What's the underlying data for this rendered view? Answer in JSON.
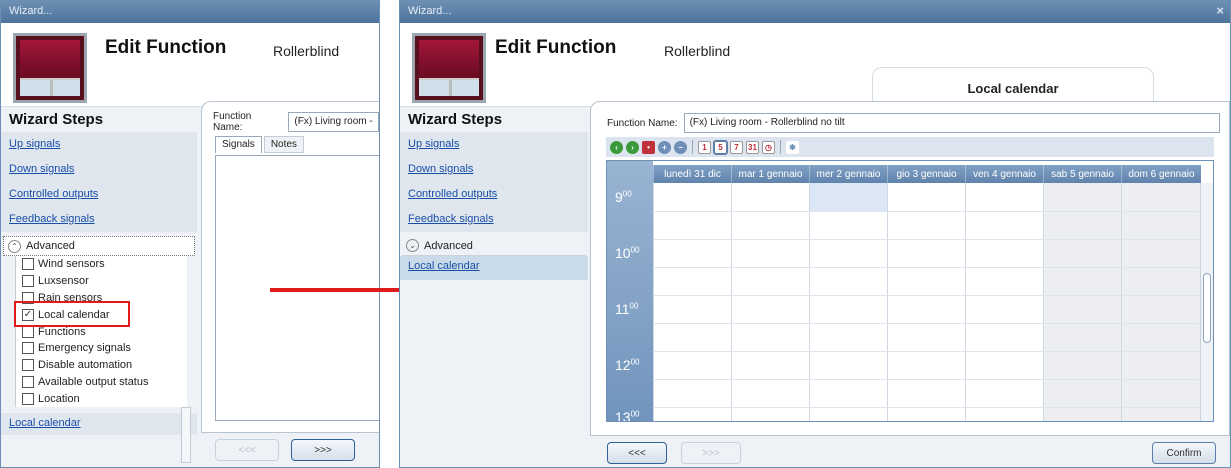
{
  "left": {
    "window_title": "Wizard...",
    "header_title": "Edit Function",
    "header_subtitle": "Rollerblind",
    "steps_title": "Wizard Steps",
    "steps": [
      "Up signals",
      "Down signals",
      "Controlled outputs",
      "Feedback signals"
    ],
    "advanced_label": "Advanced",
    "checkboxes": [
      {
        "label": "Wind sensors",
        "checked": false
      },
      {
        "label": "Luxsensor",
        "checked": false
      },
      {
        "label": "Rain sensors",
        "checked": false
      },
      {
        "label": "Local calendar",
        "checked": true
      },
      {
        "label": "Functions",
        "checked": false
      },
      {
        "label": "Emergency signals",
        "checked": false
      },
      {
        "label": "Disable automation",
        "checked": false
      },
      {
        "label": "Available output status",
        "checked": false
      },
      {
        "label": "Location",
        "checked": false
      }
    ],
    "extra_step": "Local calendar",
    "function_name_label": "Function Name:",
    "function_name_value": "(Fx) Living room -",
    "tabs": [
      "Signals",
      "Notes"
    ],
    "prev_button": "<<<",
    "next_button": ">>>"
  },
  "right": {
    "window_title": "Wizard...",
    "close_glyph": "×",
    "header_title": "Edit Function",
    "header_subtitle": "Rollerblind",
    "tab_title": "Local calendar",
    "steps_title": "Wizard Steps",
    "steps": [
      "Up signals",
      "Down signals",
      "Controlled outputs",
      "Feedback signals"
    ],
    "advanced_label": "Advanced",
    "active_step": "Local calendar",
    "function_name_label": "Function Name:",
    "function_name_value": "(Fx) Living room - Rollerblind no tilt",
    "toolbar_day_glyphs": [
      "1",
      "5",
      "7",
      "31"
    ],
    "days": [
      "lunedì 31 dic",
      "mar 1 gennaio",
      "mer 2 gennaio",
      "gio 3 gennaio",
      "ven 4 gennaio",
      "sab 5 gennaio",
      "dom 6 gennaio"
    ],
    "hours": [
      {
        "h": "9",
        "m": "00"
      },
      {
        "h": "10",
        "m": "00"
      },
      {
        "h": "11",
        "m": "00"
      },
      {
        "h": "12",
        "m": "00"
      },
      {
        "h": "13",
        "m": "00"
      }
    ],
    "prev_button": "<<<",
    "next_button": ">>>",
    "confirm_button": "Confirm"
  },
  "colors": {
    "accent": "#e01b1b",
    "header_blue": "#5f83ad"
  }
}
